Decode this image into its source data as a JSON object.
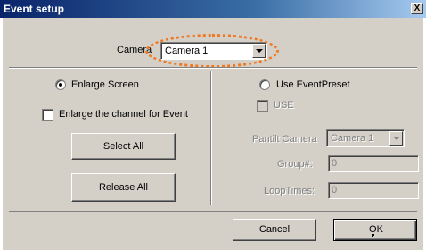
{
  "window": {
    "title": "Event setup",
    "close_label": "X"
  },
  "camera": {
    "label": "Camera",
    "selected": "Camera 1"
  },
  "left": {
    "enlarge_screen_label": "Enlarge Screen",
    "enlarge_channel_label": "Enlarge the channel for Event",
    "select_all_label": "Select All",
    "release_all_label": "Release All"
  },
  "right": {
    "use_eventpreset_label": "Use EventPreset",
    "use_label": "USE",
    "pantilt_camera_label": "Pantilt Camera",
    "pantilt_camera_value": "Camera 1",
    "group_label": "Group#:",
    "group_value": "0",
    "looptimes_label": "LoopTimes:",
    "looptimes_value": "0"
  },
  "footer": {
    "cancel_label": "Cancel",
    "ok_label": "OK"
  },
  "colors": {
    "highlight": "#f07820",
    "title_bar": "#0a246a"
  }
}
